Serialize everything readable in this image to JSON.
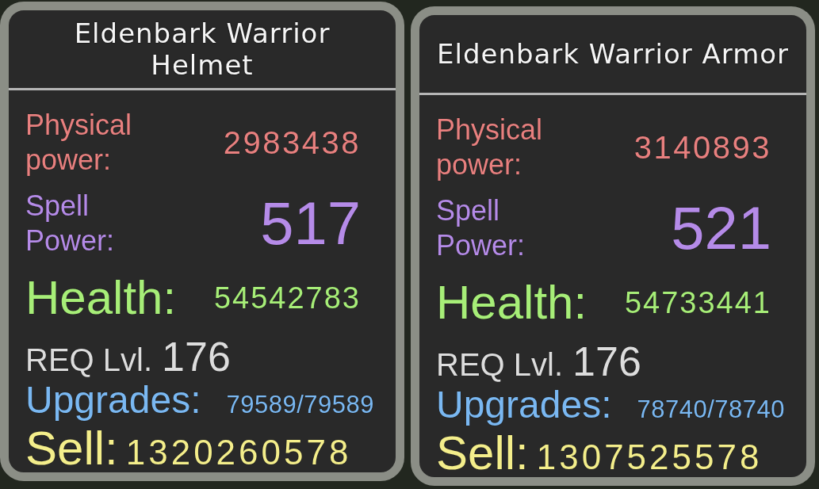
{
  "tooltips": [
    {
      "title": "Eldenbark Warrior Helmet",
      "stats": [
        {
          "kind": "physical",
          "label": "Physical power:",
          "value": "2983438"
        },
        {
          "kind": "spell",
          "label": "Spell Power:",
          "value": "517"
        },
        {
          "kind": "health",
          "label": "Health:",
          "value": "54542783"
        },
        {
          "kind": "level",
          "label": "REQ Lvl.",
          "value": "176"
        },
        {
          "kind": "upgrades",
          "label": "Upgrades:",
          "value": "79589/79589"
        },
        {
          "kind": "sell",
          "label": "Sell:",
          "value": "1320260578"
        }
      ]
    },
    {
      "title": "Eldenbark Warrior Armor",
      "stats": [
        {
          "kind": "physical",
          "label": "Physical power:",
          "value": "3140893"
        },
        {
          "kind": "spell",
          "label": "Spell Power:",
          "value": "521"
        },
        {
          "kind": "health",
          "label": "Health:",
          "value": "54733441"
        },
        {
          "kind": "level",
          "label": "REQ Lvl.",
          "value": "176"
        },
        {
          "kind": "upgrades",
          "label": "Upgrades:",
          "value": "78740/78740"
        },
        {
          "kind": "sell",
          "label": "Sell:",
          "value": "1307525578"
        }
      ]
    }
  ]
}
